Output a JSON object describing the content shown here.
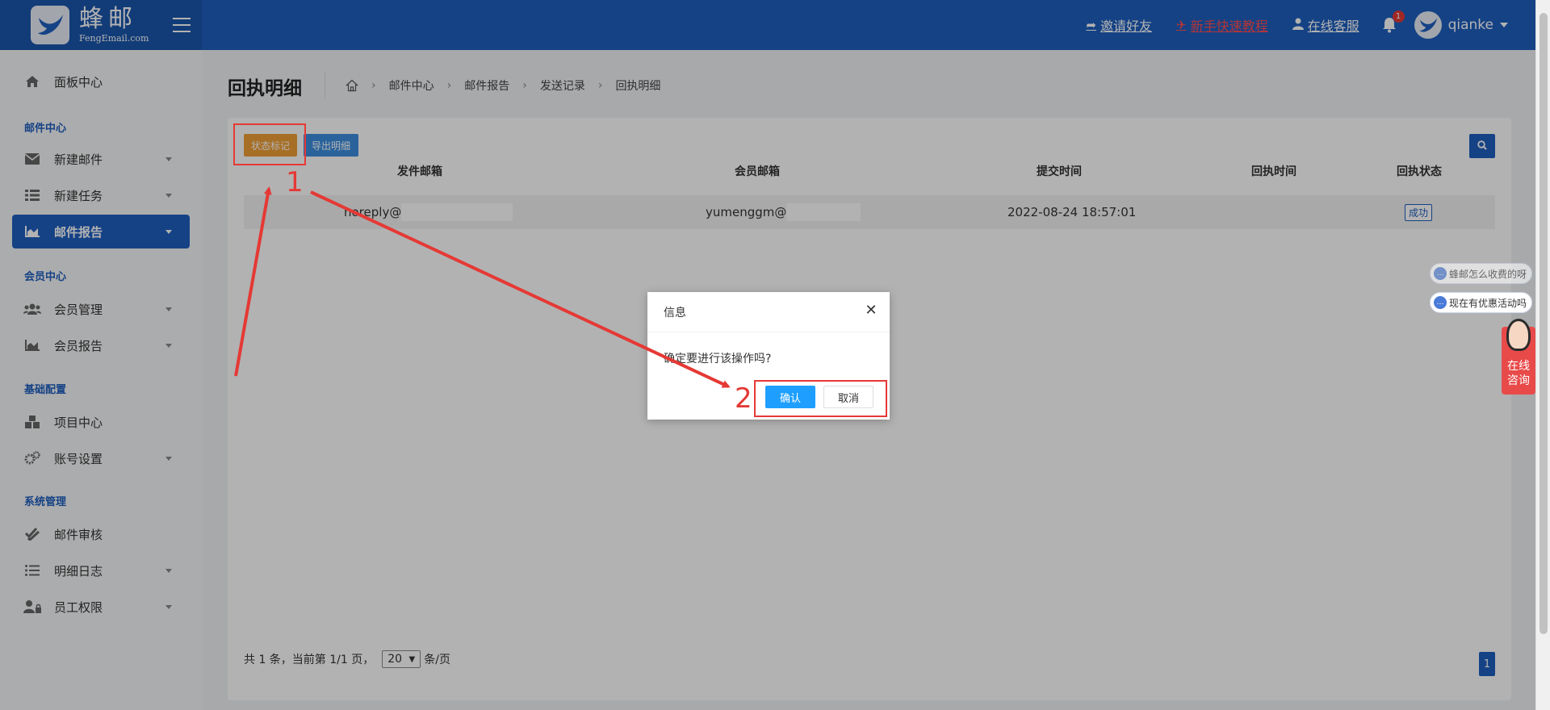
{
  "header": {
    "logo_cn": "蜂邮",
    "logo_en": "FengEmail.com",
    "links": [
      {
        "label": "邀请好友",
        "icon": "share-icon"
      },
      {
        "label": "新手快速教程",
        "icon": "rocket-icon"
      },
      {
        "label": "在线客服",
        "icon": "user-icon"
      }
    ],
    "notification_count": "1",
    "username": "qianke"
  },
  "sidebar": {
    "items": [
      {
        "label": "面板中心",
        "icon": "home-icon"
      },
      {
        "label": "新建邮件",
        "icon": "envelope-icon"
      },
      {
        "label": "新建任务",
        "icon": "list-icon"
      },
      {
        "label": "邮件报告",
        "icon": "area-chart-icon"
      },
      {
        "label": "会员管理",
        "icon": "users-icon"
      },
      {
        "label": "会员报告",
        "icon": "area-chart-icon"
      },
      {
        "label": "项目中心",
        "icon": "boxes-icon"
      },
      {
        "label": "账号设置",
        "icon": "gears-icon"
      },
      {
        "label": "邮件审核",
        "icon": "check-double-icon"
      },
      {
        "label": "明细日志",
        "icon": "list-ul-icon"
      },
      {
        "label": "员工权限",
        "icon": "user-lock-icon"
      }
    ],
    "sections": [
      "邮件中心",
      "会员中心",
      "基础配置",
      "系统管理"
    ]
  },
  "page": {
    "title": "回执明细",
    "breadcrumb": [
      "邮件中心",
      "邮件报告",
      "发送记录",
      "回执明细"
    ]
  },
  "toolbar": {
    "status_mark_label": "状态标记",
    "export_label": "导出明细"
  },
  "table": {
    "columns": [
      "发件邮箱",
      "会员邮箱",
      "提交时间",
      "回执时间",
      "回执状态"
    ],
    "rows": [
      {
        "sender": "noreply@",
        "member": "yumenggm@",
        "submit_time": "2022-08-24 18:57:01",
        "receipt_time": "",
        "status": "成功"
      }
    ]
  },
  "pagination": {
    "summary": "共 1 条，当前第 1/1 页，",
    "page_size": "20",
    "unit": "条/页",
    "current_page": "1"
  },
  "floating": {
    "msg1": "蜂邮怎么收费的呀",
    "msg2": "现在有优惠活动吗",
    "consult_line1": "在线",
    "consult_line2": "咨询"
  },
  "dialog": {
    "title": "信息",
    "message": "确定要进行该操作吗?",
    "ok_label": "确认",
    "cancel_label": "取消"
  },
  "annotations": {
    "step1": "1",
    "step2": "2",
    "color": "#e53935"
  },
  "colors": {
    "brand": "#1f5fbf",
    "warning": "#f0a037",
    "info": "#3d8fe0",
    "dialog_primary": "#1e9fff"
  }
}
